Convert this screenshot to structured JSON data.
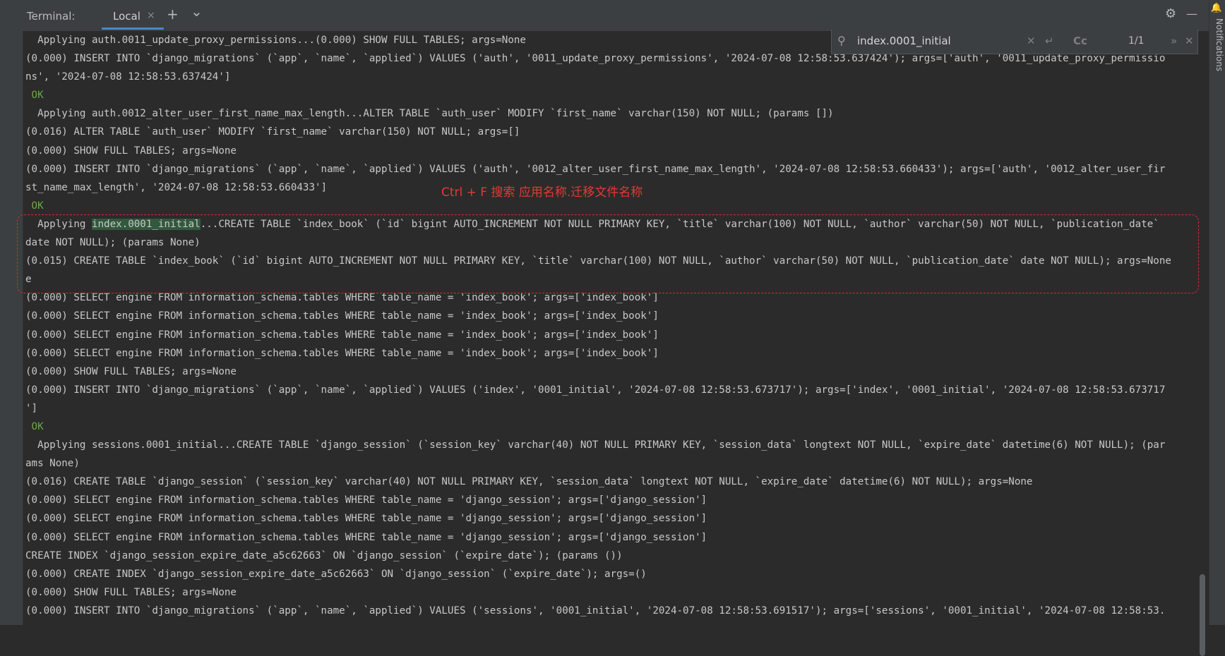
{
  "toolbar": {
    "title": "Terminal:",
    "tab_label": "Local",
    "tab_close": "×",
    "add": "+",
    "dropdown": "⌄",
    "settings": "⚙",
    "minimize": "—"
  },
  "search": {
    "query": "index.0001_initial",
    "match_case": "Cc",
    "counter": "1/1"
  },
  "annotation": "Ctrl + F 搜索 应用名称.迁移文件名称",
  "notifications_label": "Notifications",
  "terminal": {
    "lines": [
      "  Applying auth.0011_update_proxy_permissions...(0.000) SHOW FULL TABLES; args=None",
      "(0.000) INSERT INTO `django_migrations` (`app`, `name`, `applied`) VALUES ('auth', '0011_update_proxy_permissions', '2024-07-08 12:58:53.637424'); args=['auth', '0011_update_proxy_permissio",
      "ns', '2024-07-08 12:58:53.637424']",
      " OK",
      "  Applying auth.0012_alter_user_first_name_max_length...ALTER TABLE `auth_user` MODIFY `first_name` varchar(150) NOT NULL; (params [])",
      "(0.016) ALTER TABLE `auth_user` MODIFY `first_name` varchar(150) NOT NULL; args=[]",
      "(0.000) SHOW FULL TABLES; args=None",
      "(0.000) INSERT INTO `django_migrations` (`app`, `name`, `applied`) VALUES ('auth', '0012_alter_user_first_name_max_length', '2024-07-08 12:58:53.660433'); args=['auth', '0012_alter_user_fir",
      "st_name_max_length', '2024-07-08 12:58:53.660433']",
      " OK",
      "  Applying index.0001_initial...CREATE TABLE `index_book` (`id` bigint AUTO_INCREMENT NOT NULL PRIMARY KEY, `title` varchar(100) NOT NULL, `author` varchar(50) NOT NULL, `publication_date`",
      "date NOT NULL); (params None)",
      "(0.015) CREATE TABLE `index_book` (`id` bigint AUTO_INCREMENT NOT NULL PRIMARY KEY, `title` varchar(100) NOT NULL, `author` varchar(50) NOT NULL, `publication_date` date NOT NULL); args=None",
      "e",
      "(0.000) SELECT engine FROM information_schema.tables WHERE table_name = 'index_book'; args=['index_book']",
      "(0.000) SELECT engine FROM information_schema.tables WHERE table_name = 'index_book'; args=['index_book']",
      "(0.000) SELECT engine FROM information_schema.tables WHERE table_name = 'index_book'; args=['index_book']",
      "(0.000) SELECT engine FROM information_schema.tables WHERE table_name = 'index_book'; args=['index_book']",
      "(0.000) SHOW FULL TABLES; args=None",
      "(0.000) INSERT INTO `django_migrations` (`app`, `name`, `applied`) VALUES ('index', '0001_initial', '2024-07-08 12:58:53.673717'); args=['index', '0001_initial', '2024-07-08 12:58:53.673717",
      "']",
      " OK",
      "  Applying sessions.0001_initial...CREATE TABLE `django_session` (`session_key` varchar(40) NOT NULL PRIMARY KEY, `session_data` longtext NOT NULL, `expire_date` datetime(6) NOT NULL); (par",
      "ams None)",
      "(0.016) CREATE TABLE `django_session` (`session_key` varchar(40) NOT NULL PRIMARY KEY, `session_data` longtext NOT NULL, `expire_date` datetime(6) NOT NULL); args=None",
      "(0.000) SELECT engine FROM information_schema.tables WHERE table_name = 'django_session'; args=['django_session']",
      "(0.000) SELECT engine FROM information_schema.tables WHERE table_name = 'django_session'; args=['django_session']",
      "(0.000) SELECT engine FROM information_schema.tables WHERE table_name = 'django_session'; args=['django_session']",
      "CREATE INDEX `django_session_expire_date_a5c62663` ON `django_session` (`expire_date`); (params ())",
      "(0.000) CREATE INDEX `django_session_expire_date_a5c62663` ON `django_session` (`expire_date`); args=()",
      "(0.000) SHOW FULL TABLES; args=None",
      "(0.000) INSERT INTO `django_migrations` (`app`, `name`, `applied`) VALUES ('sessions', '0001_initial', '2024-07-08 12:58:53.691517'); args=['sessions', '0001_initial', '2024-07-08 12:58:53."
    ]
  },
  "colors": {
    "background": "#2b2b2b",
    "text": "#c8c8c8",
    "ok": "#6aa84f",
    "highlight": "#32593d",
    "annotation": "#e53935",
    "tab_accent": "#4a88c7"
  }
}
